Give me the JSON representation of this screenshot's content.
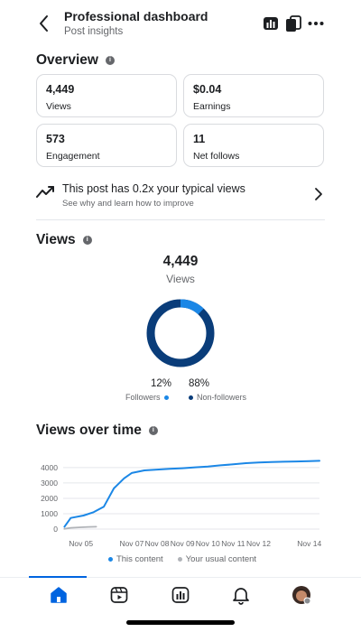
{
  "header": {
    "title": "Professional dashboard",
    "subtitle": "Post insights",
    "icons": [
      "back-icon",
      "bar-chart-icon",
      "copy-icon",
      "more-icon"
    ]
  },
  "overview": {
    "title": "Overview",
    "cards": [
      {
        "value": "4,449",
        "label": "Views"
      },
      {
        "value": "$0.04",
        "label": "Earnings"
      },
      {
        "value": "573",
        "label": "Engagement"
      },
      {
        "value": "11",
        "label": "Net follows"
      }
    ]
  },
  "insight": {
    "title": "This post has 0.2x your typical views",
    "subtitle": "See why and learn how to improve"
  },
  "views": {
    "title": "Views",
    "total": "4,449",
    "total_label": "Views",
    "followers_pct": "12%",
    "nonfollowers_pct": "88%",
    "followers_label": "Followers",
    "nonfollowers_label": "Non-followers",
    "followers_fraction": 0.12,
    "color_followers": "#1b87e6",
    "color_nonfollowers": "#0a3d7a"
  },
  "views_over_time": {
    "title": "Views over time",
    "legend_this": "This content",
    "legend_usual": "Your usual content"
  },
  "chart_data": {
    "type": "line",
    "title": "Views over time",
    "x_ticks": [
      "Nov 05",
      "Nov 07",
      "Nov 08",
      "Nov 09",
      "Nov 10",
      "Nov 11",
      "Nov 12",
      "Nov 14"
    ],
    "y_ticks": [
      0,
      1000,
      2000,
      3000,
      4000
    ],
    "ylim": [
      0,
      4700
    ],
    "xlim": [
      4.3,
      14.4
    ],
    "grid": "horizontal",
    "series": [
      {
        "name": "This content",
        "color": "#1b87e6",
        "x": [
          4.35,
          4.6,
          5.1,
          5.5,
          5.9,
          6.3,
          6.7,
          7.0,
          7.5,
          8.0,
          8.5,
          9.0,
          9.5,
          10.0,
          10.5,
          11.0,
          11.5,
          12.0,
          12.5,
          13.0,
          13.5,
          14.0,
          14.4
        ],
        "y": [
          150,
          720,
          880,
          1100,
          1450,
          2650,
          3300,
          3650,
          3820,
          3870,
          3920,
          3960,
          4020,
          4070,
          4150,
          4210,
          4290,
          4330,
          4360,
          4380,
          4400,
          4420,
          4440
        ]
      },
      {
        "name": "Your usual content",
        "color": "#b0b3b8",
        "x": [
          4.35,
          4.6,
          5.0,
          5.3,
          5.6
        ],
        "y": [
          20,
          80,
          120,
          140,
          150
        ]
      }
    ]
  },
  "nav": {
    "items": [
      "home-icon",
      "reels-icon",
      "insights-icon",
      "notifications-icon",
      "profile-avatar"
    ],
    "active": 0
  }
}
